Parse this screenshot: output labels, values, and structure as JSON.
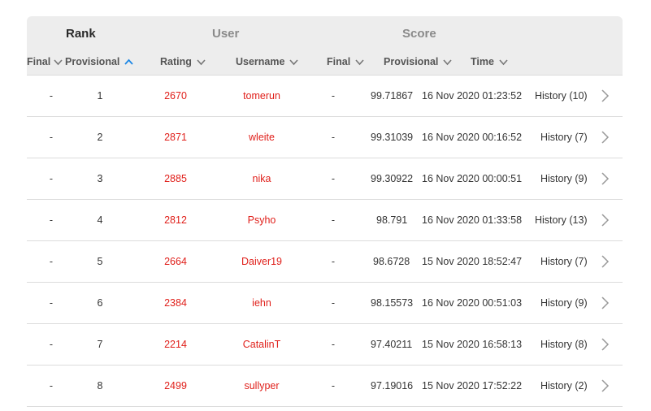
{
  "header": {
    "groups": {
      "rank": "Rank",
      "user": "User",
      "score": "Score"
    },
    "columns": {
      "rank_final": "Final",
      "rank_provisional": "Provisional",
      "rating": "Rating",
      "username": "Username",
      "score_final": "Final",
      "score_provisional": "Provisional",
      "time": "Time"
    },
    "sorted_column": "rank_provisional",
    "sort_direction": "ascending"
  },
  "colors": {
    "rating": "#e0201b",
    "username": "#e0201b",
    "sort_active": "#1e88e5",
    "header_bg": "#ededed"
  },
  "rows": [
    {
      "final_rank": "-",
      "provisional_rank": "1",
      "rating": "2670",
      "username": "tomerun",
      "final_score": "-",
      "provisional_score": "99.71867",
      "time": "16 Nov 2020 01:23:52",
      "history": "History (10)"
    },
    {
      "final_rank": "-",
      "provisional_rank": "2",
      "rating": "2871",
      "username": "wleite",
      "final_score": "-",
      "provisional_score": "99.31039",
      "time": "16 Nov 2020 00:16:52",
      "history": "History (7)"
    },
    {
      "final_rank": "-",
      "provisional_rank": "3",
      "rating": "2885",
      "username": "nika",
      "final_score": "-",
      "provisional_score": "99.30922",
      "time": "16 Nov 2020 00:00:51",
      "history": "History (9)"
    },
    {
      "final_rank": "-",
      "provisional_rank": "4",
      "rating": "2812",
      "username": "Psyho",
      "final_score": "-",
      "provisional_score": "98.791",
      "time": "16 Nov 2020 01:33:58",
      "history": "History (13)"
    },
    {
      "final_rank": "-",
      "provisional_rank": "5",
      "rating": "2664",
      "username": "Daiver19",
      "final_score": "-",
      "provisional_score": "98.6728",
      "time": "15 Nov 2020 18:52:47",
      "history": "History (7)"
    },
    {
      "final_rank": "-",
      "provisional_rank": "6",
      "rating": "2384",
      "username": "iehn",
      "final_score": "-",
      "provisional_score": "98.15573",
      "time": "16 Nov 2020 00:51:03",
      "history": "History (9)"
    },
    {
      "final_rank": "-",
      "provisional_rank": "7",
      "rating": "2214",
      "username": "CatalinT",
      "final_score": "-",
      "provisional_score": "97.40211",
      "time": "15 Nov 2020 16:58:13",
      "history": "History (8)"
    },
    {
      "final_rank": "-",
      "provisional_rank": "8",
      "rating": "2499",
      "username": "sullyper",
      "final_score": "-",
      "provisional_score": "97.19016",
      "time": "15 Nov 2020 17:52:22",
      "history": "History (2)"
    }
  ]
}
